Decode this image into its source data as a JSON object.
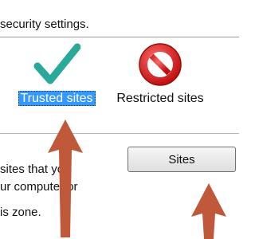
{
  "header": {
    "text": "security settings."
  },
  "zones": [
    {
      "label": "Trusted sites",
      "icon": "checkmark-icon",
      "selected": true
    },
    {
      "label": "Restricted sites",
      "icon": "no-entry-icon",
      "selected": false
    }
  ],
  "description": {
    "line1": "sites that you",
    "line2": "ur computer or",
    "line3": "is zone."
  },
  "buttons": {
    "sites_label": "Sites"
  },
  "colors": {
    "selection": "#3399ff",
    "checkmark": "#2aa89a",
    "no_entry": "#d21c1c",
    "annotation_arrow": "#c0583a"
  },
  "annotations": [
    {
      "icon": "annotation-arrow-icon",
      "points_to": "Trusted sites"
    },
    {
      "icon": "annotation-arrow-icon",
      "points_to": "Sites"
    }
  ]
}
